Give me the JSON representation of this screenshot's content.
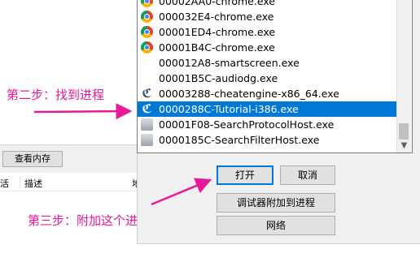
{
  "annotations": {
    "step2": "第二步：找到进程",
    "step3": "第三步：附加这个进程"
  },
  "main_window": {
    "view_memory_button": "查看内存",
    "columns": [
      "活",
      "描述",
      "地"
    ]
  },
  "process_list": {
    "items": [
      {
        "label": "00002AA0-chrome.exe",
        "icon": "chrome-icon",
        "selected": false
      },
      {
        "label": "000032E4-chrome.exe",
        "icon": "chrome-icon",
        "selected": false
      },
      {
        "label": "00001ED4-chrome.exe",
        "icon": "chrome-icon",
        "selected": false
      },
      {
        "label": "00001B4C-chrome.exe",
        "icon": "chrome-icon",
        "selected": false
      },
      {
        "label": "000012A8-smartscreen.exe",
        "icon": "",
        "selected": false
      },
      {
        "label": "00001B5C-audiodg.exe",
        "icon": "",
        "selected": false
      },
      {
        "label": "00003288-cheatengine-x86_64.exe",
        "icon": "cheatengine-icon",
        "selected": false
      },
      {
        "label": "0000288C-Tutorial-i386.exe",
        "icon": "cheatengine-icon",
        "selected": true
      },
      {
        "label": "00001F08-SearchProtocolHost.exe",
        "icon": "host-icon",
        "selected": false
      },
      {
        "label": "0000185C-SearchFilterHost.exe",
        "icon": "host-icon",
        "selected": false
      }
    ]
  },
  "dialog": {
    "open_button": "打开",
    "cancel_button": "取消",
    "attach_debugger_button": "调试器附加到进程",
    "network_button": "网络"
  },
  "colors": {
    "annotation": "#e8189a",
    "selection": "#0078d7"
  }
}
